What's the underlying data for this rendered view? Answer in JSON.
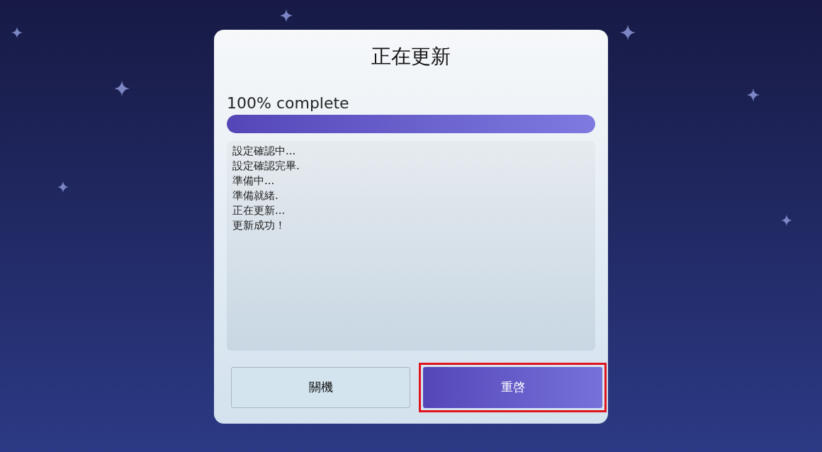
{
  "dialog": {
    "title": "正在更新",
    "progress": {
      "label": "100% complete",
      "level": 1
    },
    "log": [
      "設定確認中...",
      "設定確認完畢.",
      "準備中...",
      "準備就緒.",
      "正在更新...",
      "更新成功！"
    ],
    "buttons": [
      {
        "label": "關機",
        "selected": false,
        "highlighted": false
      },
      {
        "label": "重啓",
        "selected": true,
        "highlighted": true
      }
    ]
  }
}
